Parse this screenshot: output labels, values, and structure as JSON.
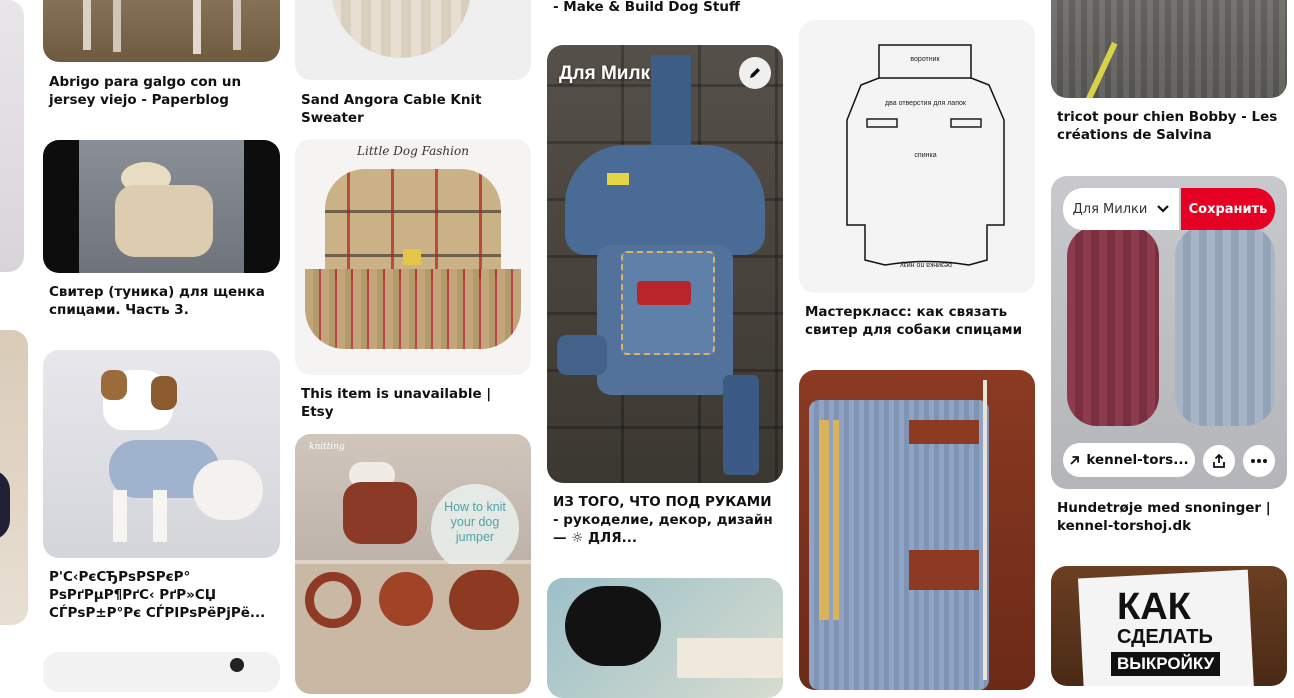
{
  "pins": {
    "col1": {
      "p1_caption": "Abrigo para galgo con un jersey viejo - Paperblog",
      "p2_caption": "Свитер (туника) для щенка спицами. Часть 3.",
      "p3_caption": "Р'С‹РєСЂРѕРЅРєР° РѕРґРµР¶РґС‹ РґР»СЏ СЃРѕР±Р°Рє СЃРІРѕРёРјРё..."
    },
    "col2": {
      "p1_caption": "Sand Angora Cable Knit Sweater",
      "p2_image_text": "Little Dog Fashion",
      "p2_caption": "This item is unavailable | Etsy",
      "p3_image_text": "How to knit your dog jumper",
      "p3_logo": "knitting"
    },
    "col3": {
      "top_caption": "- Make & Build Dog Stuff",
      "p1_board_label": "Для Милки",
      "p1_caption": "ИЗ ТОГО, ЧТО ПОД РУКАМИ - рукоделие, декор, дизайн — ☼ ДЛЯ..."
    },
    "col4": {
      "p1_text_top": "воротник",
      "p1_text_mid": "два отверстия для лапок",
      "p1_text_body": "спинка",
      "p1_text_bottom": "резинка по низу",
      "p1_caption": "Мастеркласс: как связать свитер для собаки спицами"
    },
    "col5": {
      "p1_caption": "tricot pour chien Bobby - Les créations de Salvina",
      "p2_board": "Для Милки",
      "p2_save": "Сохранить",
      "p2_link": "kennel-tors...",
      "p2_caption": "Hundetrøje med snoninger | kennel-torshoj.dk",
      "p3_text_1": "КАК",
      "p3_text_2": "СДЕЛАТЬ",
      "p3_text_3": "ВЫКРОЙКУ"
    }
  },
  "colors": {
    "save": "#e60023",
    "caption": "#111111"
  }
}
